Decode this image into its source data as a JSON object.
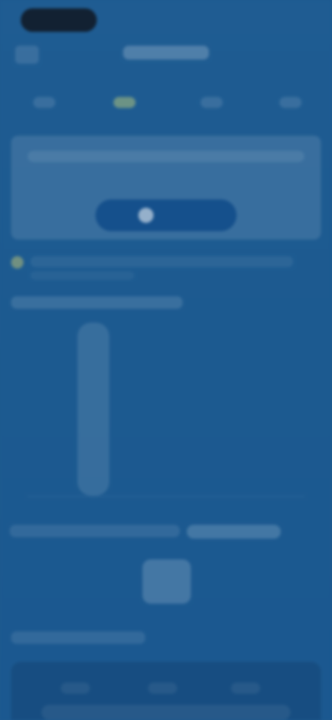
{
  "header": {
    "title": ""
  },
  "card": {
    "heading": ""
  },
  "section": {
    "title": ""
  },
  "footer": {
    "label": ""
  },
  "tabs": [
    {
      "label": ""
    },
    {
      "label": ""
    },
    {
      "label": ""
    }
  ],
  "colors": {
    "background": "#1e5a90",
    "accent": "#d2d36e"
  }
}
